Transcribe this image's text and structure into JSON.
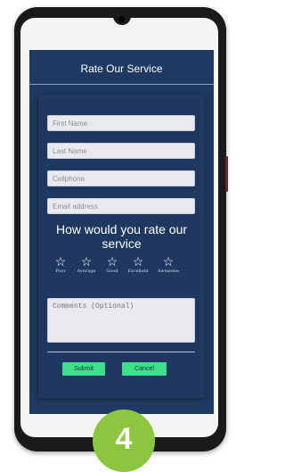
{
  "header": {
    "title": "Rate Our Service"
  },
  "form": {
    "first_name_placeholder": "First Name",
    "last_name_placeholder": "Last Name",
    "cellphone_placeholder": "Cellphone",
    "email_placeholder": "Email address"
  },
  "rating": {
    "question": "How would you rate our service",
    "options": [
      {
        "label": "Poor",
        "icon": "star-outline-icon"
      },
      {
        "label": "Average",
        "icon": "star-outline-icon"
      },
      {
        "label": "Good",
        "icon": "star-outline-icon"
      },
      {
        "label": "Excellent",
        "icon": "star-outline-icon"
      },
      {
        "label": "Awesome",
        "icon": "star-outline-icon"
      }
    ]
  },
  "comments": {
    "placeholder": "Comments (Optional)"
  },
  "actions": {
    "submit_label": "Submit",
    "cancel_label": "Cancel"
  },
  "badge": {
    "number": "4"
  },
  "colors": {
    "app_background": "#1f3a62",
    "button_green": "#3be089",
    "badge_green": "#8cc63f"
  }
}
